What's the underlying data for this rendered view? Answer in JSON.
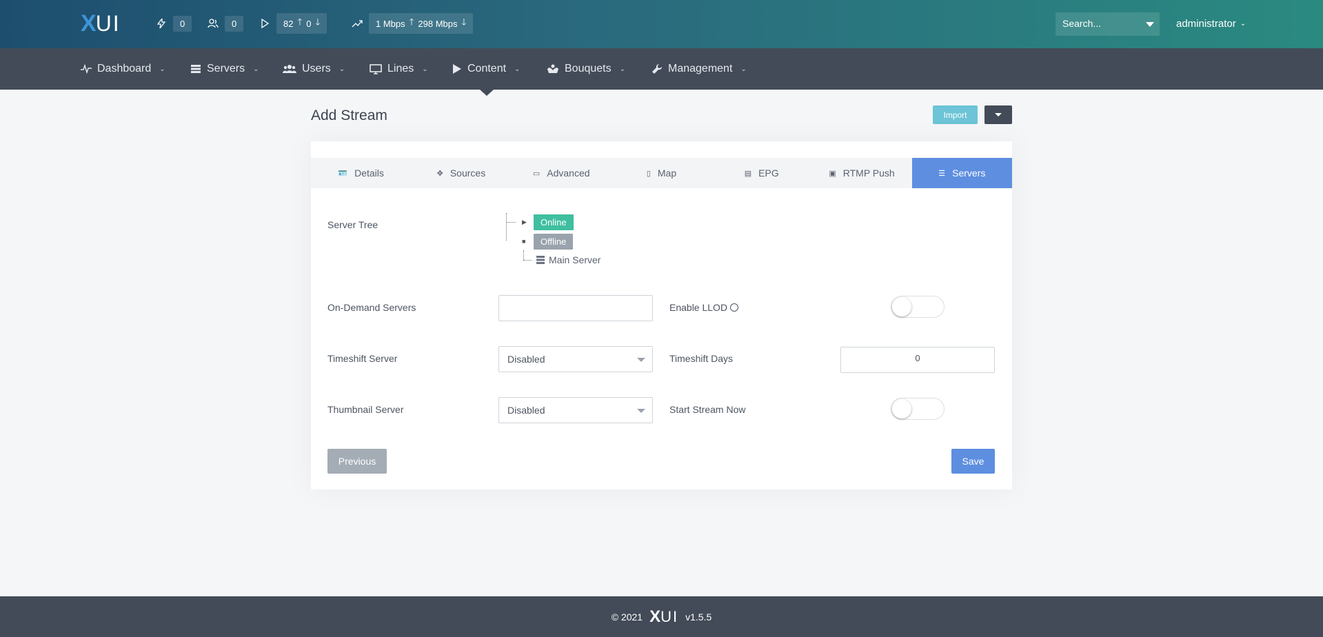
{
  "header": {
    "logo_x": "X",
    "logo_ui": "UI",
    "stats": [
      {
        "icon": "bolt-icon",
        "value": "0"
      },
      {
        "icon": "users-icon",
        "value": "0"
      },
      {
        "icon": "play-icon",
        "value": "82",
        "value2": "0"
      },
      {
        "icon": "trend-icon",
        "up": "1 Mbps",
        "down": "298 Mbps"
      }
    ],
    "search_placeholder": "Search...",
    "user": "administrator"
  },
  "nav": {
    "items": [
      {
        "label": "Dashboard",
        "icon": "pulse-icon"
      },
      {
        "label": "Servers",
        "icon": "server-icon"
      },
      {
        "label": "Users",
        "icon": "users-icon"
      },
      {
        "label": "Lines",
        "icon": "monitor-icon"
      },
      {
        "label": "Content",
        "icon": "play-icon"
      },
      {
        "label": "Bouquets",
        "icon": "flower-icon"
      },
      {
        "label": "Management",
        "icon": "wrench-icon"
      }
    ]
  },
  "page": {
    "title": "Add Stream",
    "import_label": "Import"
  },
  "tabs": [
    {
      "label": "Details",
      "icon": "id-card-icon"
    },
    {
      "label": "Sources",
      "icon": "move-icon"
    },
    {
      "label": "Advanced",
      "icon": "folder-icon"
    },
    {
      "label": "Map",
      "icon": "map-icon"
    },
    {
      "label": "EPG",
      "icon": "tv-guide-icon"
    },
    {
      "label": "RTMP Push",
      "icon": "push-icon"
    },
    {
      "label": "Servers",
      "icon": "server-icon",
      "active": true
    }
  ],
  "form": {
    "server_tree_label": "Server Tree",
    "tree": {
      "online": "Online",
      "offline": "Offline",
      "main_server": "Main Server"
    },
    "on_demand_label": "On-Demand Servers",
    "on_demand_value": "",
    "enable_llod_label": "Enable LLOD",
    "timeshift_server_label": "Timeshift Server",
    "timeshift_server_value": "Disabled",
    "timeshift_days_label": "Timeshift Days",
    "timeshift_days_value": "0",
    "thumbnail_server_label": "Thumbnail Server",
    "thumbnail_server_value": "Disabled",
    "start_stream_label": "Start Stream Now",
    "previous_label": "Previous",
    "save_label": "Save"
  },
  "footer": {
    "copyright": "© 2021",
    "logo_x": "X",
    "logo_ui": "UI",
    "version": "v1.5.5"
  }
}
